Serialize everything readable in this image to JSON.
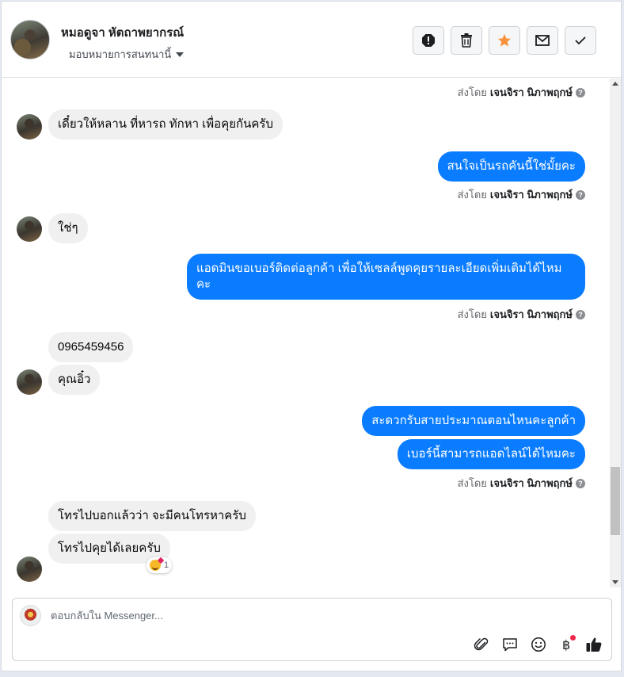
{
  "header": {
    "contact_name": "หมอดูจา หัตถาพยากรณ์",
    "assign_label": "มอบหมายการสนทนานี้",
    "actions": [
      {
        "name": "spam-button",
        "icon": "exclamation-octagon-icon"
      },
      {
        "name": "delete-button",
        "icon": "trash-icon"
      },
      {
        "name": "star-button",
        "icon": "star-icon"
      },
      {
        "name": "mark-unread-button",
        "icon": "envelope-icon"
      },
      {
        "name": "mark-done-button",
        "icon": "check-icon"
      }
    ]
  },
  "sent_by": {
    "prefix": "ส่งโดย",
    "name": "เจนจิรา นิภาพฤกษ์",
    "help": "?"
  },
  "messages": [
    {
      "dir": "in",
      "text": "เดี๋ยวให้หลาน ที่หารถ ทักหา เพื่อคุยกันครับ"
    },
    {
      "dir": "out",
      "text": "สนใจเป็นรถคันนี้ใช่มั้ยคะ"
    },
    {
      "dir": "in",
      "text": "ใช่ๆ"
    },
    {
      "dir": "out",
      "text": "แอดมินขอเบอร์ติดต่อลูกค้า เพื่อให้เซลล์พูดคุยรายละเอียดเพิ่มเติมได้ไหมคะ"
    },
    {
      "dir": "in",
      "text": "0965459456"
    },
    {
      "dir": "in",
      "text": "คุณอิ๋ว"
    },
    {
      "dir": "out",
      "text": "สะดวกรับสายประมาณตอนไหนคะลูกค้า"
    },
    {
      "dir": "out",
      "text": "เบอร์นี้สามารถแอดไลน์ได้ไหมคะ"
    },
    {
      "dir": "in",
      "text": "โทรไปบอกแล้วว่า จะมีคนโทรหาครับ"
    },
    {
      "dir": "in",
      "text": "โทรไปคุยได้เลยครับ",
      "reaction": {
        "emoji": "smiling-face-with-hearts",
        "count": "1"
      }
    }
  ],
  "composer": {
    "placeholder": "ตอบกลับใน Messenger..."
  },
  "colors": {
    "outgoing": "#0a7cff",
    "incoming": "#f0f0f0",
    "star": "#f7923b",
    "badge": "#f02849"
  }
}
